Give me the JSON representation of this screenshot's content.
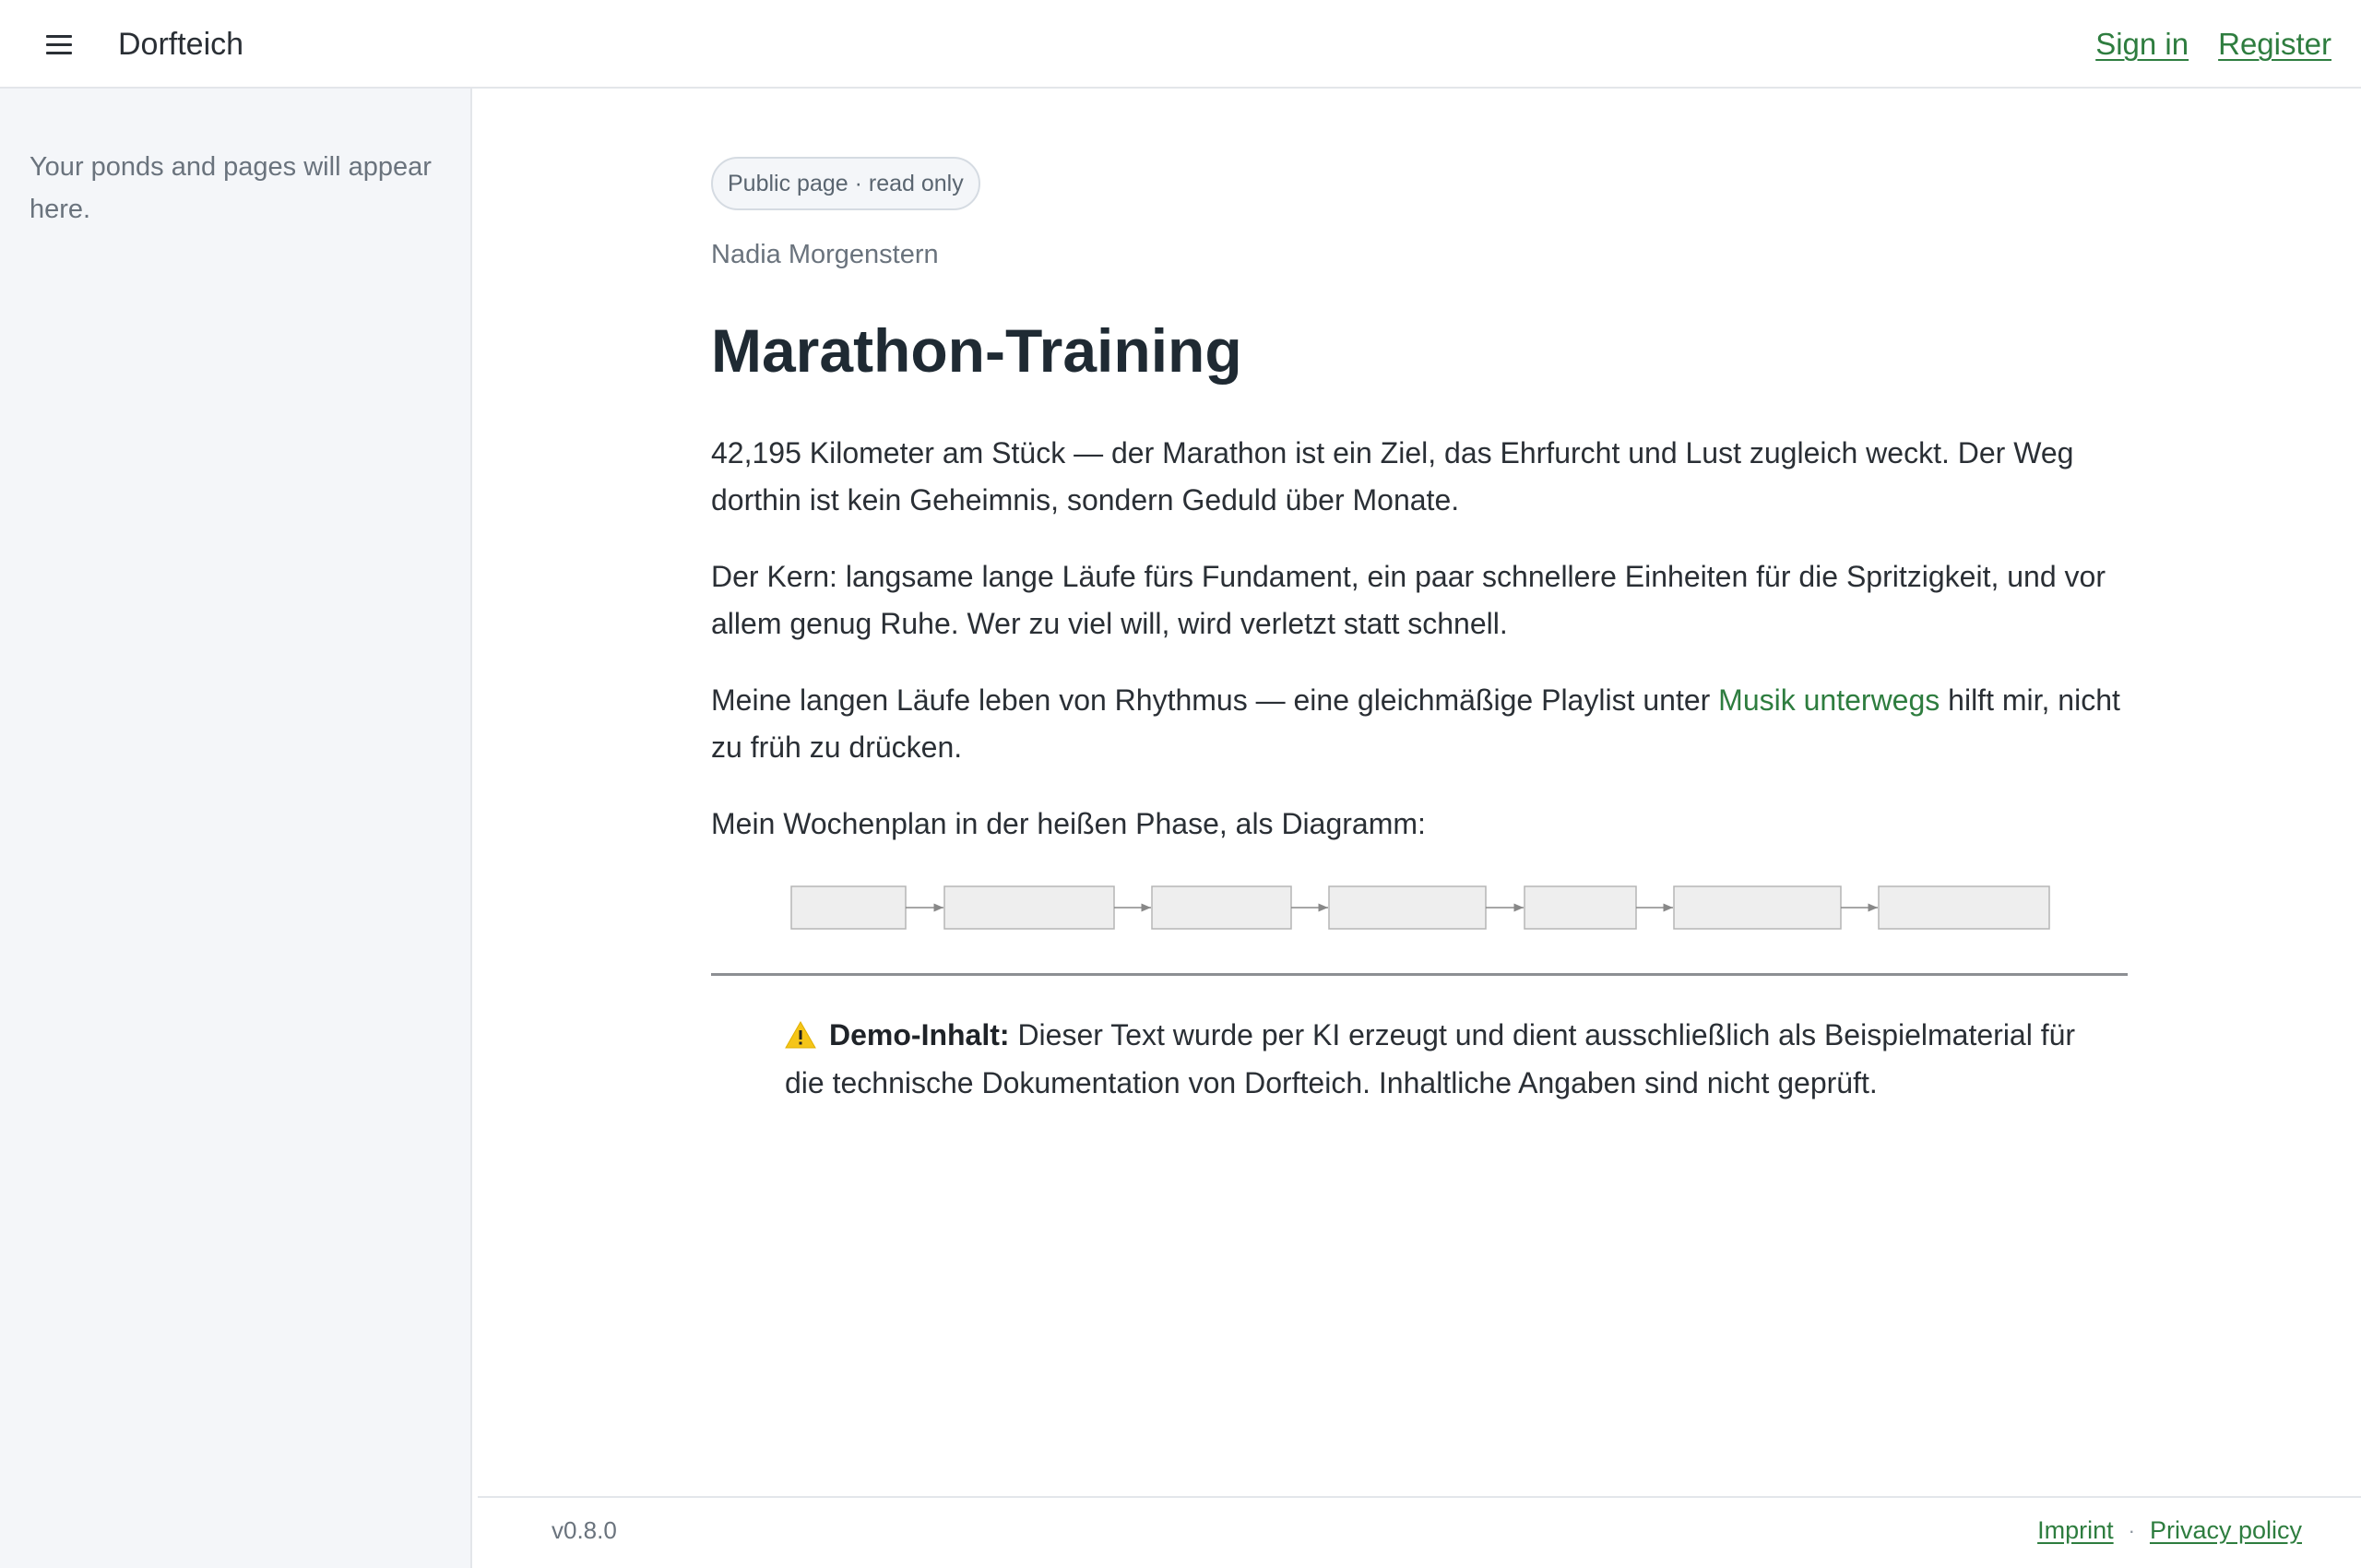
{
  "header": {
    "brand": "Dorfteich",
    "sign_in": "Sign in",
    "register": "Register"
  },
  "sidebar": {
    "empty_text": "Your ponds and pages will appear here."
  },
  "page": {
    "badge": "Public page · read only",
    "author": "Nadia Morgenstern",
    "title": "Marathon-Training",
    "para1": "42,195 Kilometer am Stück — der Marathon ist ein Ziel, das Ehrfurcht und Lust zugleich weckt. Der Weg dorthin ist kein Geheimnis, sondern Geduld über Monate.",
    "para2": "Der Kern: langsame lange Läufe fürs Fundament, ein paar schnellere Einheiten für die Spritzigkeit, und vor allem genug Ruhe. Wer zu viel will, wird verletzt statt schnell.",
    "para3_before": "Meine langen Läufe leben von Rhythmus — eine gleichmäßige Playlist unter ",
    "para3_link": "Musik unterwegs",
    "para3_after": " hilft mir, nicht zu früh zu drücken.",
    "para4": "Mein Wochenplan in der heißen Phase, als Diagramm:",
    "diagram": {
      "node_count": 7,
      "node_fill": "#eeeeee",
      "node_stroke": "#b5b5b5",
      "arrow_color": "#888888"
    },
    "notice": {
      "label": "Demo-Inhalt:",
      "text": " Dieser Text wurde per KI erzeugt und dient ausschließlich als Beispielmaterial für die technische Dokumentation von Dorfteich. Inhaltliche Angaben sind nicht geprüft."
    }
  },
  "footer": {
    "version": "v0.8.0",
    "imprint": "Imprint",
    "separator": "·",
    "privacy": "Privacy policy"
  },
  "colors": {
    "accent": "#2e7d3f",
    "sidebar_bg": "#f4f6f9",
    "warning": "#f5c518"
  }
}
